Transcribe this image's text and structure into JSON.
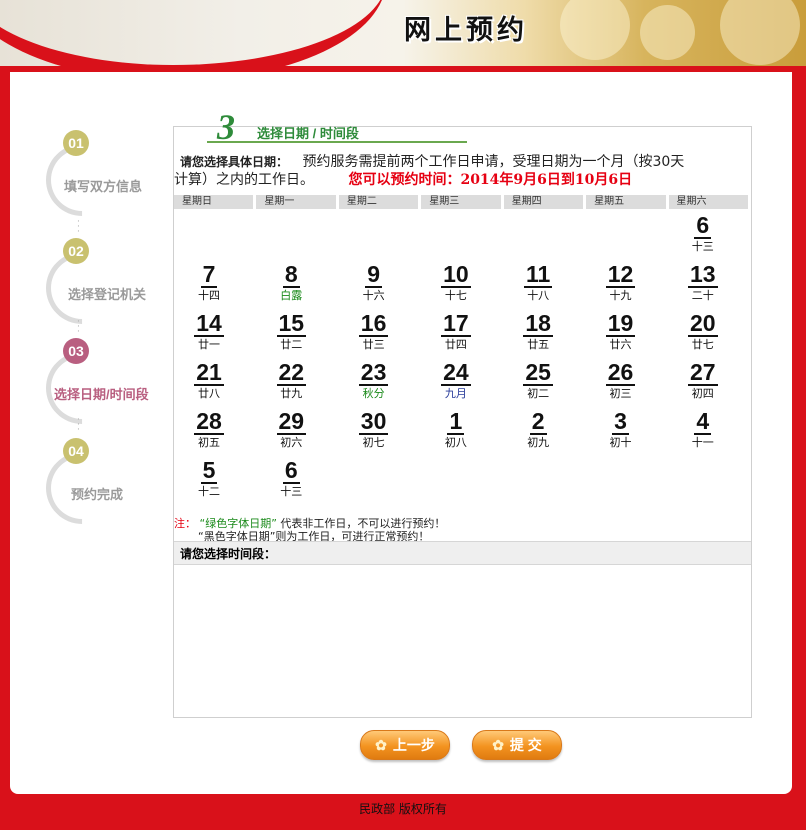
{
  "header": {
    "title": "网上预约"
  },
  "steps": [
    {
      "num": "01",
      "label": "填写双方信息",
      "active": false
    },
    {
      "num": "02",
      "label": "选择登记机关",
      "active": false
    },
    {
      "num": "03",
      "label": "选择日期/时间段",
      "active": true
    },
    {
      "num": "04",
      "label": "预约完成",
      "active": false
    }
  ],
  "step_tab": {
    "num": "3",
    "label": "选择日期 / 时间段"
  },
  "intro": {
    "lead": "请您选择具体日期：",
    "text_1": "预约服务需提前两个工作日申请，受理日期为一个月（按30天",
    "text_2": "计算）之内的工作日。",
    "notice": "您可以预约时间：2014年9月6日到10月6日"
  },
  "weekdays": [
    "星期日",
    "星期一",
    "星期二",
    "星期三",
    "星期四",
    "星期五",
    "星期六"
  ],
  "calendar": [
    {
      "day": "6",
      "lunar": "十三",
      "row": 0,
      "col": 6,
      "type": "normal"
    },
    {
      "day": "7",
      "lunar": "十四",
      "row": 1,
      "col": 0,
      "type": "normal"
    },
    {
      "day": "8",
      "lunar": "白露",
      "row": 1,
      "col": 1,
      "type": "green"
    },
    {
      "day": "9",
      "lunar": "十六",
      "row": 1,
      "col": 2,
      "type": "normal"
    },
    {
      "day": "10",
      "lunar": "十七",
      "row": 1,
      "col": 3,
      "type": "normal"
    },
    {
      "day": "11",
      "lunar": "十八",
      "row": 1,
      "col": 4,
      "type": "normal"
    },
    {
      "day": "12",
      "lunar": "十九",
      "row": 1,
      "col": 5,
      "type": "normal"
    },
    {
      "day": "13",
      "lunar": "二十",
      "row": 1,
      "col": 6,
      "type": "normal"
    },
    {
      "day": "14",
      "lunar": "廿一",
      "row": 2,
      "col": 0,
      "type": "normal"
    },
    {
      "day": "15",
      "lunar": "廿二",
      "row": 2,
      "col": 1,
      "type": "normal"
    },
    {
      "day": "16",
      "lunar": "廿三",
      "row": 2,
      "col": 2,
      "type": "normal"
    },
    {
      "day": "17",
      "lunar": "廿四",
      "row": 2,
      "col": 3,
      "type": "normal"
    },
    {
      "day": "18",
      "lunar": "廿五",
      "row": 2,
      "col": 4,
      "type": "normal"
    },
    {
      "day": "19",
      "lunar": "廿六",
      "row": 2,
      "col": 5,
      "type": "normal"
    },
    {
      "day": "20",
      "lunar": "廿七",
      "row": 2,
      "col": 6,
      "type": "normal"
    },
    {
      "day": "21",
      "lunar": "廿八",
      "row": 3,
      "col": 0,
      "type": "normal"
    },
    {
      "day": "22",
      "lunar": "廿九",
      "row": 3,
      "col": 1,
      "type": "normal"
    },
    {
      "day": "23",
      "lunar": "秋分",
      "row": 3,
      "col": 2,
      "type": "green"
    },
    {
      "day": "24",
      "lunar": "九月",
      "row": 3,
      "col": 3,
      "type": "blue"
    },
    {
      "day": "25",
      "lunar": "初二",
      "row": 3,
      "col": 4,
      "type": "normal"
    },
    {
      "day": "26",
      "lunar": "初三",
      "row": 3,
      "col": 5,
      "type": "normal"
    },
    {
      "day": "27",
      "lunar": "初四",
      "row": 3,
      "col": 6,
      "type": "normal"
    },
    {
      "day": "28",
      "lunar": "初五",
      "row": 4,
      "col": 0,
      "type": "normal"
    },
    {
      "day": "29",
      "lunar": "初六",
      "row": 4,
      "col": 1,
      "type": "normal"
    },
    {
      "day": "30",
      "lunar": "初七",
      "row": 4,
      "col": 2,
      "type": "normal"
    },
    {
      "day": "1",
      "lunar": "初八",
      "row": 4,
      "col": 3,
      "type": "normal"
    },
    {
      "day": "2",
      "lunar": "初九",
      "row": 4,
      "col": 4,
      "type": "normal"
    },
    {
      "day": "3",
      "lunar": "初十",
      "row": 4,
      "col": 5,
      "type": "normal"
    },
    {
      "day": "4",
      "lunar": "十一",
      "row": 4,
      "col": 6,
      "type": "normal"
    },
    {
      "day": "5",
      "lunar": "十二",
      "row": 5,
      "col": 0,
      "type": "normal"
    },
    {
      "day": "6",
      "lunar": "十三",
      "row": 5,
      "col": 1,
      "type": "normal"
    }
  ],
  "note": {
    "prefix": "注：",
    "line1_quoted": "“绿色字体日期”",
    "line1_rest": "代表非工作日，不可以进行预约！",
    "line2": "“黑色字体日期”则为工作日，可进行正常预约！"
  },
  "time_section": {
    "heading": "请您选择时间段："
  },
  "buttons": {
    "prev": "上一步",
    "submit": "提 交"
  },
  "footer": {
    "line1": "民政部 版权所有"
  },
  "colors": {
    "brand_red": "#d9111a",
    "notice_red": "#e60012",
    "step_green": "#2e8b3a",
    "active_step": "#b95f80",
    "button_orange": "#f39320"
  }
}
